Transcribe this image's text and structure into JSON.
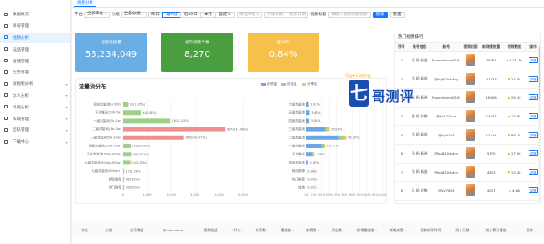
{
  "sidebar": {
    "items": [
      {
        "label": "数据概况",
        "caret": ""
      },
      {
        "label": "账号管理",
        "caret": ""
      },
      {
        "label": "视频分析",
        "caret": "",
        "active": true
      },
      {
        "label": "选品管理",
        "caret": ""
      },
      {
        "label": "直播管理",
        "caret": ""
      },
      {
        "label": "任务管理",
        "caret": ""
      },
      {
        "label": "短视频分析",
        "caret": "▾"
      },
      {
        "label": "达人分析",
        "caret": "▾"
      },
      {
        "label": "电商分析",
        "caret": "▾"
      },
      {
        "label": "私域管理",
        "caret": "▾"
      },
      {
        "label": "团队管理",
        "caret": "▾"
      },
      {
        "label": "下载中心",
        "caret": "▾"
      }
    ]
  },
  "tabbar": {
    "active_tab": "视频分析"
  },
  "filters": {
    "platform_label": "平台",
    "platform_value": "全部平台",
    "group_label": "分组",
    "group_value": "全部分组",
    "segments": [
      "昨日",
      "近7日",
      "近30日",
      "本月",
      "自定义"
    ],
    "range_label": "近7日",
    "account_placeholder": "请选择账号",
    "date_placeholder": "开始日期 ~ 结束日期",
    "keyword_label": "视频标题",
    "keyword_placeholder": "请输入视频标题搜索",
    "search_btn": "搜索",
    "reset_btn": "重置"
  },
  "kpis": [
    {
      "label": "视频播放量",
      "value": "53,234,049",
      "color": "#6aaee6"
    },
    {
      "label": "发布视频个数",
      "value": "8,270",
      "color": "#4a9e3f"
    },
    {
      "label": "互动率",
      "value": "0.84%",
      "color": "#f7c04a"
    }
  ],
  "chart": {
    "title": "流量池分布",
    "legend": [
      {
        "name": "点赞量",
        "color": "#6aa6e8"
      },
      {
        "name": "评论量",
        "color": "#9ed08a"
      },
      {
        "name": "分享量",
        "color": "#f2c45a"
      }
    ]
  },
  "chart_data": [
    {
      "type": "bar",
      "categories": [
        "初始流量池(0-500)",
        "千次曝光(500-5k)",
        "一级流量池(5k-1w)",
        "二级流量池(1w-5w)",
        "三级流量池(5w-10w)",
        "四级流量池(10w-50w)",
        "五级流量池(50w-100w)",
        "六级流量池(100w-500w)",
        "七级流量池(500w+)",
        "精品推荐",
        "热门推荐"
      ],
      "values": [
        2.05,
        7.58,
        19.75,
        42.52,
        25.24,
        3.04,
        3.62,
        2.81,
        0.06,
        0.03,
        0.01
      ],
      "value_labels": [
        "82(1.05%)",
        "4(0.06%)",
        "181(2.05%)",
        "3671(41.46%)",
        "3650(41.87%)",
        "130(2.39%)",
        "46(0.52%)",
        "11(0.13%)",
        "17(0.19%)",
        "9(0.10%)",
        "3(0.03%)"
      ],
      "xticks": [
        "0",
        "1,000",
        "2,000",
        "3,000",
        "4,000",
        "5,000"
      ]
    },
    {
      "type": "bar",
      "categories": [
        "六级流量池",
        "五级流量池",
        "四级流量池",
        "三级流量池",
        "二级流量池",
        "一级流量池",
        "千次曝光",
        "初始流量池",
        "精品推荐",
        "热门推荐",
        "其他"
      ],
      "series": [
        {
          "name": "点赞量",
          "values": [
            2.81,
            3.62,
            3.04,
            25.24,
            42.52,
            19.75,
            7.58,
            2.05,
            0.06,
            0.03,
            0.01
          ]
        },
        {
          "name": "评论量",
          "values": [
            0.4,
            0.5,
            0.6,
            3.0,
            6.1,
            3.3,
            1.2,
            0.3,
            0.0,
            0.0,
            0.0
          ]
        },
        {
          "name": "分享量",
          "values": [
            0.2,
            0.3,
            0.4,
            2.0,
            4.1,
            2.2,
            0.8,
            0.2,
            0.0,
            0.0,
            0.0
          ]
        }
      ],
      "value_labels": [
        "2.81%",
        "3.62%",
        "3.04%",
        "25.24%",
        "42.52%",
        "19.75%",
        "7.58%",
        "2.05%",
        "0.06%",
        "0.03%",
        "0.01%"
      ],
      "xticks": [
        "0%",
        "10%",
        "20%",
        "30%",
        "40%",
        "50%",
        "60%",
        "70%",
        "80%",
        "90%",
        "100%"
      ]
    }
  ],
  "rank_table": {
    "title": "热门视频排行",
    "headers": [
      "序号",
      "账号信息",
      "账号",
      "视频封面",
      "新增播放量",
      "视频数据",
      "操作"
    ],
    "rows": [
      {
        "num": "1",
        "name": "马 妈 精选",
        "account": "@homeliving816...",
        "plays": "26781",
        "data": "111.3k"
      },
      {
        "num": "2",
        "name": "马 妈 精选",
        "account": "@by8204ntry",
        "plays": "21233",
        "data": "27.5k"
      },
      {
        "num": "3",
        "name": "马 妈 精选",
        "account": "@homeliving816...",
        "plays": "16806",
        "data": "29.1k"
      },
      {
        "num": "4",
        "name": "美 妈 好物",
        "account": "@by1157us",
        "plays": "14837",
        "data": "12.6k"
      },
      {
        "num": "5",
        "name": "马 妈 精选",
        "account": "@by0104",
        "plays": "12514",
        "data": "89.7k"
      },
      {
        "num": "6",
        "name": "马 妈 精选",
        "account": "@by8204ntry",
        "plays": "9170",
        "data": "17.9k"
      },
      {
        "num": "7",
        "name": "马 妈 精选",
        "account": "@by8204ntry",
        "plays": "4833",
        "data": "13.4k"
      },
      {
        "num": "8",
        "name": "乐 妈 好物",
        "account": "@by7803",
        "plays": "4037",
        "data": "4.6k"
      }
    ],
    "action_label": "详情"
  },
  "bottom_table": {
    "headers": [
      "排名",
      "分组",
      "账号类型",
      "@username",
      "视频描述",
      "时长",
      "分享数",
      "播放量",
      "点赞数",
      "评论数",
      "新增播放量",
      "新增点赞",
      "获取新增时间",
      "统计天数",
      "统计累计播放",
      "操作"
    ]
  },
  "watermark": {
    "mark": "七",
    "text": "哥测评",
    "sub": "Qige Ceping"
  }
}
